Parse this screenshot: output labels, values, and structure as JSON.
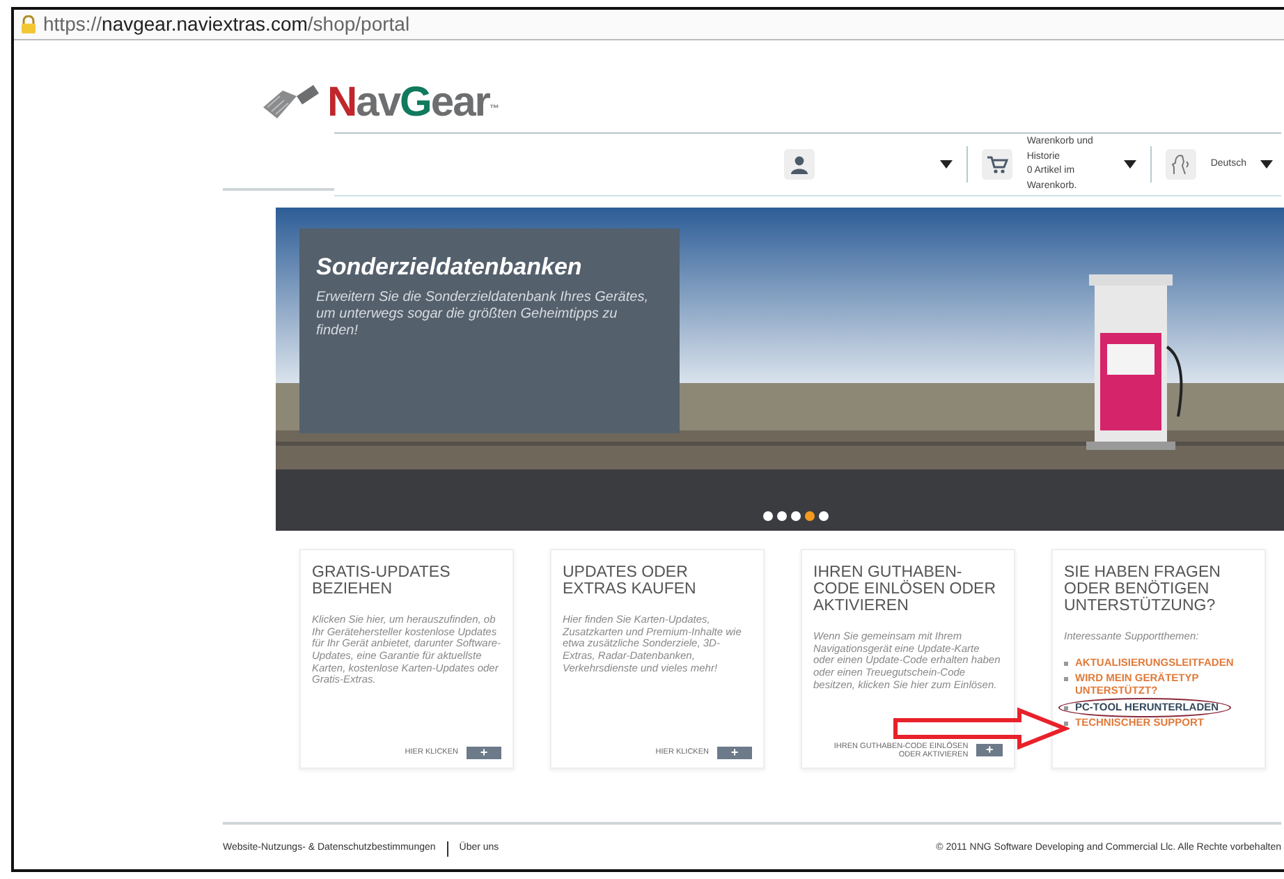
{
  "address_bar": {
    "url_prefix": "https://",
    "url_host": "navgear.naviextras.com",
    "url_path": "/shop/portal"
  },
  "logo": {
    "parts": [
      {
        "text": "N",
        "color": "#c0272d"
      },
      {
        "text": "av",
        "color": "#6d6e70"
      },
      {
        "text": "G",
        "color": "#0f7a5c"
      },
      {
        "text": "ear",
        "color": "#6d6e70"
      }
    ],
    "mark": "™"
  },
  "header": {
    "cart": {
      "title": "Warenkorb und Historie",
      "count": "0 Artikel im Warenkorb."
    },
    "language": "Deutsch"
  },
  "banner": {
    "title": "Sonderzieldatenbanken",
    "text": "Erweitern Sie die Sonderzieldatenbank Ihres Gerätes, um unterwegs sogar die größten Geheimtipps zu finden!",
    "dots": [
      {
        "selected": false
      },
      {
        "selected": false
      },
      {
        "selected": false
      },
      {
        "selected": true
      },
      {
        "selected": false
      }
    ]
  },
  "cards": [
    {
      "kind": "action",
      "title": "GRATIS-UPDATES BEZIEHEN",
      "text": "Klicken Sie hier, um herauszufinden, ob Ihr Gerätehersteller kostenlose Updates für Ihr Gerät anbietet, darunter Software-Updates, eine Garantie für aktuellste Karten, kostenlose Karten-Updates oder Gratis-Extras.",
      "link": "HIER KLICKEN",
      "button": "+"
    },
    {
      "kind": "action",
      "title": "UPDATES ODER EXTRAS KAUFEN",
      "text": "Hier finden Sie Karten-Updates, Zusatzkarten und Premium-Inhalte wie etwa zusätzliche Sonderziele, 3D-Extras, Radar-Datenbanken, Verkehrsdienste und vieles mehr!",
      "link": "HIER KLICKEN",
      "button": "+"
    },
    {
      "kind": "action",
      "title": "IHREN GUTHABEN-CODE EINLÖSEN ODER AKTIVIEREN",
      "text": "Wenn Sie gemeinsam mit Ihrem Navigationsgerät eine Update-Karte oder einen Update-Code erhalten haben oder einen Treuegutschein-Code besitzen, klicken Sie hier zum Einlösen.",
      "link": "IHREN GUTHABEN-CODE EINLÖSEN ODER AKTIVIEREN",
      "button": "+"
    },
    {
      "kind": "support",
      "title": "SIE HABEN FRAGEN ODER BENÖTIGEN UNTERSTÜTZUNG?",
      "text": "Interessante Supportthemen:",
      "topics": [
        {
          "label": "AKTUALISIERUNGSLEITFADEN",
          "circled": false
        },
        {
          "label": "WIRD MEIN GERÄTETYP UNTERSTÜTZT?",
          "circled": false
        },
        {
          "label": "PC-TOOL HERUNTERLADEN",
          "circled": true
        },
        {
          "label": "TECHNISCHER SUPPORT",
          "circled": false
        }
      ]
    }
  ],
  "footer": {
    "links": [
      "Website-Nutzungs- & Datenschutzbestimmungen",
      "Über uns"
    ],
    "copyright": "© 2011 NNG Software Developing and Commercial Llc. Alle Rechte vorbehalten"
  }
}
